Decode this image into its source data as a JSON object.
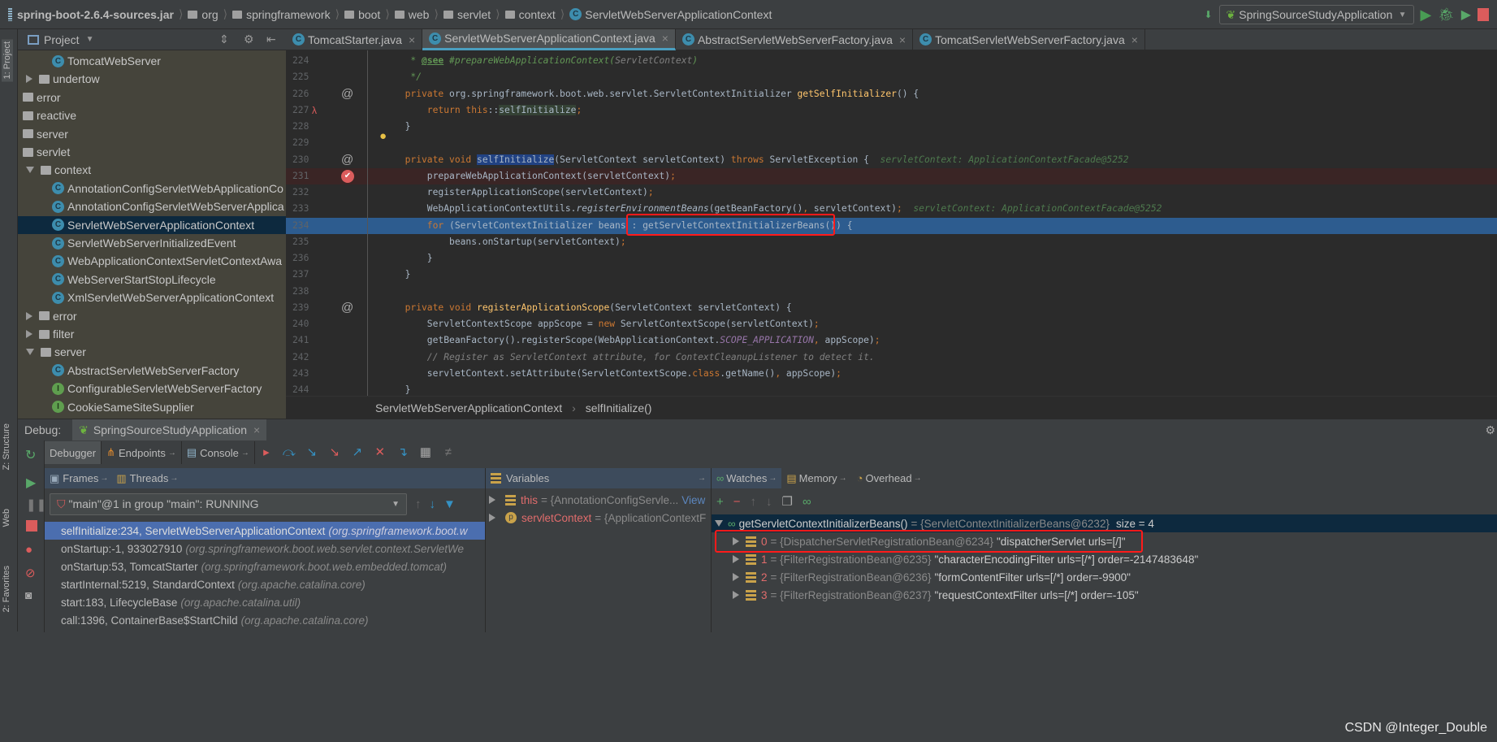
{
  "navbar": {
    "crumbs": [
      "spring-boot-2.6.4-sources.jar",
      "org",
      "springframework",
      "boot",
      "web",
      "servlet",
      "context",
      "ServletWebServerApplicationContext"
    ],
    "run_config": "SpringSourceStudyApplication"
  },
  "left_strip": {
    "project_tab": "1: Project",
    "structure_tab": "Z: Structure",
    "web_tab": "Web",
    "favorites_tab": "2: Favorites"
  },
  "project": {
    "title": "Project",
    "tree": [
      {
        "label": "TomcatWebServer",
        "kind": "class",
        "level": 2
      },
      {
        "label": "undertow",
        "kind": "folder",
        "level": 1,
        "arrow": "closed"
      },
      {
        "label": "error",
        "kind": "package",
        "level": 0
      },
      {
        "label": "reactive",
        "kind": "package",
        "level": 0
      },
      {
        "label": "server",
        "kind": "package",
        "level": 0
      },
      {
        "label": "servlet",
        "kind": "package",
        "level": 0
      },
      {
        "label": "context",
        "kind": "folder",
        "level": 1,
        "arrow": "open"
      },
      {
        "label": "AnnotationConfigServletWebApplicationCo",
        "kind": "class",
        "level": 2
      },
      {
        "label": "AnnotationConfigServletWebServerApplica",
        "kind": "class",
        "level": 2
      },
      {
        "label": "ServletWebServerApplicationContext",
        "kind": "class",
        "level": 2,
        "selected": true
      },
      {
        "label": "ServletWebServerInitializedEvent",
        "kind": "class",
        "level": 2
      },
      {
        "label": "WebApplicationContextServletContextAwa",
        "kind": "class",
        "level": 2
      },
      {
        "label": "WebServerStartStopLifecycle",
        "kind": "class",
        "level": 2
      },
      {
        "label": "XmlServletWebServerApplicationContext",
        "kind": "class",
        "level": 2
      },
      {
        "label": "error",
        "kind": "folder",
        "level": 1,
        "arrow": "closed"
      },
      {
        "label": "filter",
        "kind": "folder",
        "level": 1,
        "arrow": "closed"
      },
      {
        "label": "server",
        "kind": "folder",
        "level": 1,
        "arrow": "open"
      },
      {
        "label": "AbstractServletWebServerFactory",
        "kind": "class",
        "level": 2
      },
      {
        "label": "ConfigurableServletWebServerFactory",
        "kind": "interface",
        "level": 2
      },
      {
        "label": "CookieSameSiteSupplier",
        "kind": "interface",
        "level": 2
      }
    ]
  },
  "editor": {
    "tabs": [
      {
        "label": "TomcatStarter.java"
      },
      {
        "label": "ServletWebServerApplicationContext.java",
        "active": true
      },
      {
        "label": "AbstractServletWebServerFactory.java"
      },
      {
        "label": "TomcatServletWebServerFactory.java"
      }
    ],
    "lines": [
      {
        "n": "224",
        "tok": [
          [
            "cm",
            "   * "
          ],
          [
            "tag",
            "@see"
          ],
          [
            "cm",
            " #prepareWebApplicationContext("
          ],
          [
            "gc",
            "ServletContext"
          ],
          [
            "cm",
            ")"
          ]
        ]
      },
      {
        "n": "225",
        "tok": [
          [
            "cm",
            "   */"
          ]
        ]
      },
      {
        "n": "226",
        "gutter": "@",
        "tok": [
          [
            "kw",
            "  private "
          ],
          [
            "",
            "org.springframework.boot.web.servlet.ServletContextInitializer "
          ],
          [
            "fnd",
            "getSelfInitializer"
          ],
          [
            "",
            "() {"
          ]
        ]
      },
      {
        "n": "227",
        "gutter": "λ",
        "tok": [
          [
            "kw",
            "      return this"
          ],
          [
            "",
            "::"
          ],
          [
            "ref",
            "selfInitialize"
          ],
          [
            "kw",
            ";"
          ]
        ]
      },
      {
        "n": "228",
        "tok": [
          [
            "",
            "  }"
          ]
        ]
      },
      {
        "n": "229",
        "gutter": "💡",
        "tok": []
      },
      {
        "n": "230",
        "gutter": "@",
        "tok": [
          [
            "kw",
            "  private void "
          ],
          [
            "selw",
            "selfInitialize"
          ],
          [
            "",
            "(ServletContext servletContext) "
          ],
          [
            "kw",
            "throws "
          ],
          [
            "",
            "ServletException {  "
          ],
          [
            "hint",
            "servletContext: ApplicationContextFacade@5252"
          ]
        ]
      },
      {
        "n": "231",
        "bp": true,
        "tok": [
          [
            "",
            "      prepareWebApplicationContext(servletContext)"
          ],
          [
            "kw",
            ";"
          ]
        ]
      },
      {
        "n": "232",
        "tok": [
          [
            "",
            "      registerApplicationScope(servletContext)"
          ],
          [
            "kw",
            ";"
          ]
        ]
      },
      {
        "n": "233",
        "tok": [
          [
            "",
            "      WebApplicationContextUtils."
          ],
          [
            "it",
            "registerEnvironmentBeans"
          ],
          [
            "",
            "(getBeanFactory()"
          ],
          [
            "kw",
            ", "
          ],
          [
            "",
            "servletContext)"
          ],
          [
            "kw",
            ";  "
          ],
          [
            "hint",
            "servletContext: ApplicationContextFacade@5252"
          ]
        ]
      },
      {
        "n": "234",
        "exec": true,
        "tok": [
          [
            "kw",
            "      for "
          ],
          [
            "",
            "(ServletContextInitializer beans : "
          ],
          [
            "",
            "getServletContextInitializerBeans()) {"
          ]
        ]
      },
      {
        "n": "235",
        "tok": [
          [
            "",
            "          beans.onStartup(servletContext)"
          ],
          [
            "kw",
            ";"
          ]
        ]
      },
      {
        "n": "236",
        "tok": [
          [
            "",
            "      }"
          ]
        ]
      },
      {
        "n": "237",
        "tok": [
          [
            "",
            "  }"
          ]
        ]
      },
      {
        "n": "238",
        "tok": []
      },
      {
        "n": "239",
        "gutter": "@",
        "tok": [
          [
            "kw",
            "  private void "
          ],
          [
            "fnd",
            "registerApplicationScope"
          ],
          [
            "",
            "(ServletContext servletContext) {"
          ]
        ]
      },
      {
        "n": "240",
        "tok": [
          [
            "",
            "      ServletContextScope appScope = "
          ],
          [
            "kw",
            "new "
          ],
          [
            "",
            "ServletContextScope(servletContext)"
          ],
          [
            "kw",
            ";"
          ]
        ]
      },
      {
        "n": "241",
        "tok": [
          [
            "",
            "      getBeanFactory().registerScope(WebApplicationContext."
          ],
          [
            "st",
            "SCOPE_APPLICATION"
          ],
          [
            "kw",
            ", "
          ],
          [
            "",
            "appScope)"
          ],
          [
            "kw",
            ";"
          ]
        ]
      },
      {
        "n": "242",
        "tok": [
          [
            "gc",
            "      // Register as ServletContext attribute, for ContextCleanupListener to detect it."
          ]
        ]
      },
      {
        "n": "243",
        "tok": [
          [
            "",
            "      servletContext.setAttribute(ServletContextScope."
          ],
          [
            "kw",
            "class"
          ],
          [
            "",
            ".getName()"
          ],
          [
            "kw",
            ", "
          ],
          [
            "",
            "appScope)"
          ],
          [
            "kw",
            ";"
          ]
        ]
      },
      {
        "n": "244",
        "tok": [
          [
            "",
            "  }"
          ]
        ]
      }
    ],
    "breadcrumb": [
      "ServletWebServerApplicationContext",
      "selfInitialize()"
    ]
  },
  "debug": {
    "label": "Debug:",
    "session": "SpringSourceStudyApplication",
    "tabs": [
      "Debugger",
      "Endpoints",
      "Console"
    ],
    "frames_tab": "Frames",
    "threads_tab": "Threads",
    "thread_select": "\"main\"@1 in group \"main\": RUNNING",
    "frames": [
      {
        "m": "selfInitialize:234, ServletWebServerApplicationContext",
        "p": "(org.springframework.boot.w",
        "selected": true
      },
      {
        "m": "onStartup:-1, 933027910",
        "p": "(org.springframework.boot.web.servlet.context.ServletWe"
      },
      {
        "m": "onStartup:53, TomcatStarter",
        "p": "(org.springframework.boot.web.embedded.tomcat)"
      },
      {
        "m": "startInternal:5219, StandardContext",
        "p": "(org.apache.catalina.core)"
      },
      {
        "m": "start:183, LifecycleBase",
        "p": "(org.apache.catalina.util)"
      },
      {
        "m": "call:1396, ContainerBase$StartChild",
        "p": "(org.apache.catalina.core)"
      }
    ],
    "variables_title": "Variables",
    "variables": [
      {
        "name": "this",
        "value": "= {AnnotationConfigServle...",
        "link": "View",
        "icon": "field"
      },
      {
        "name": "servletContext",
        "value": "= {ApplicationContextF",
        "icon": "param"
      }
    ],
    "watch_tabs": [
      "Watches",
      "Memory",
      "Overhead"
    ],
    "watch_root": {
      "expr": "getServletContextInitializerBeans()",
      "value": "= {ServletContextInitializerBeans@6232}",
      "size": "size = 4"
    },
    "watch_children": [
      {
        "idx": "0",
        "ref": "= {DispatcherServletRegistrationBean@6234}",
        "str": "\"dispatcherServlet urls=[/]\""
      },
      {
        "idx": "1",
        "ref": "= {FilterRegistrationBean@6235}",
        "str": "\"characterEncodingFilter urls=[/*] order=-2147483648\""
      },
      {
        "idx": "2",
        "ref": "= {FilterRegistrationBean@6236}",
        "str": "\"formContentFilter urls=[/*] order=-9900\""
      },
      {
        "idx": "3",
        "ref": "= {FilterRegistrationBean@6237}",
        "str": "\"requestContextFilter urls=[/*] order=-105\""
      }
    ]
  },
  "watermark": "CSDN @Integer_Double",
  "colors": {
    "accent": "#4a9ebf",
    "exec_line": "#2d5c8f",
    "highlight_box": "#ff1a1a"
  }
}
